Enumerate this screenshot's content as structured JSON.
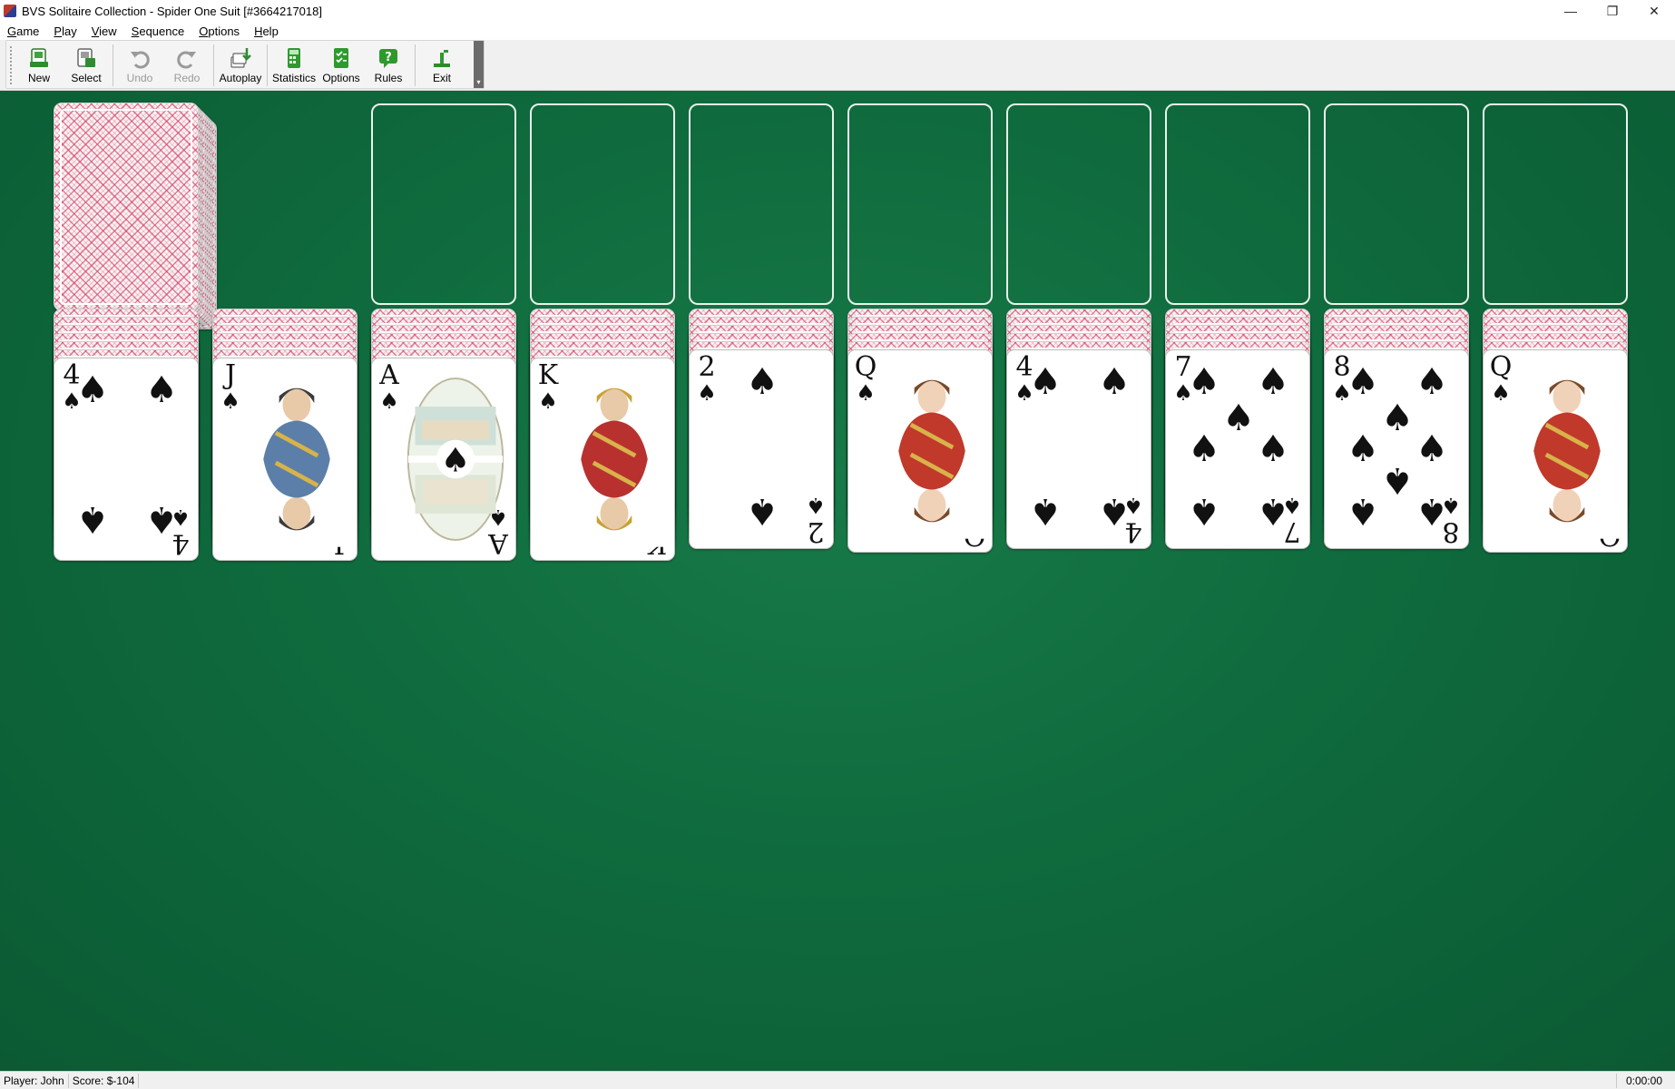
{
  "window": {
    "title": "BVS Solitaire Collection  -  Spider One Suit [#3664217018]",
    "minimize": "—",
    "restore": "❐",
    "close": "✕"
  },
  "menu": [
    {
      "key": "G",
      "rest": "ame"
    },
    {
      "key": "P",
      "rest": "lay"
    },
    {
      "key": "V",
      "rest": "iew"
    },
    {
      "key": "S",
      "rest": "equence"
    },
    {
      "key": "O",
      "rest": "ptions"
    },
    {
      "key": "H",
      "rest": "elp"
    }
  ],
  "toolbar": {
    "new": "New",
    "select": "Select",
    "undo": "Undo",
    "redo": "Redo",
    "autoplay": "Autoplay",
    "statistics": "Statistics",
    "options": "Options",
    "rules": "Rules",
    "exit": "Exit",
    "overflow": "▾"
  },
  "game": {
    "suit_symbol": "♠",
    "foundations_empty": 8,
    "stock_remaining_stacks": 5,
    "tableau": [
      {
        "face_down": 6,
        "face_up": {
          "rank": "4",
          "kind": "pip"
        }
      },
      {
        "face_down": 6,
        "face_up": {
          "rank": "J",
          "kind": "court"
        }
      },
      {
        "face_down": 6,
        "face_up": {
          "rank": "A",
          "kind": "ace"
        }
      },
      {
        "face_down": 6,
        "face_up": {
          "rank": "K",
          "kind": "court"
        }
      },
      {
        "face_down": 5,
        "face_up": {
          "rank": "2",
          "kind": "pip"
        }
      },
      {
        "face_down": 5,
        "face_up": {
          "rank": "Q",
          "kind": "court"
        }
      },
      {
        "face_down": 5,
        "face_up": {
          "rank": "4",
          "kind": "pip"
        }
      },
      {
        "face_down": 5,
        "face_up": {
          "rank": "7",
          "kind": "pip"
        }
      },
      {
        "face_down": 5,
        "face_up": {
          "rank": "8",
          "kind": "pip"
        }
      },
      {
        "face_down": 5,
        "face_up": {
          "rank": "Q",
          "kind": "court"
        }
      }
    ]
  },
  "status": {
    "player": "Player: John",
    "score": "Score: $-104",
    "time": "0:00:00"
  }
}
